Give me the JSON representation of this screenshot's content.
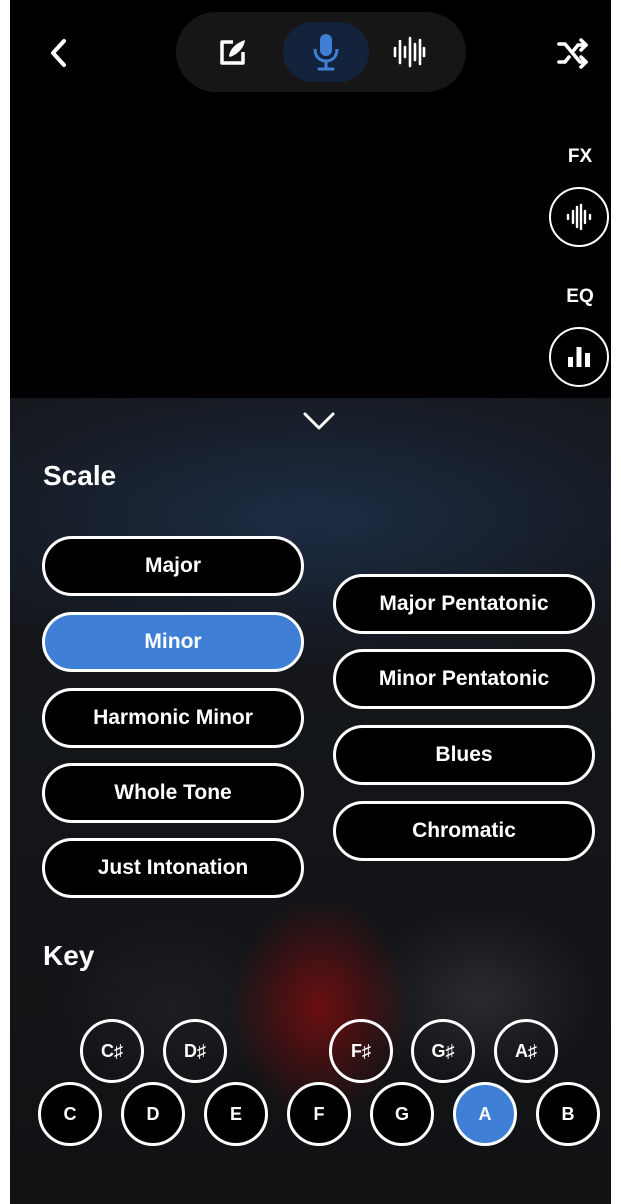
{
  "header": {
    "back_icon": "chevron-left-icon",
    "modes": [
      {
        "icon": "edit-icon",
        "active": false
      },
      {
        "icon": "microphone-icon",
        "active": true
      },
      {
        "icon": "waveform-icon",
        "active": false
      }
    ],
    "shuffle_icon": "shuffle-icon"
  },
  "controls": {
    "fx_label": "FX",
    "fx_icon": "audio-wave-icon",
    "eq_label": "EQ",
    "eq_icon": "bar-chart-icon"
  },
  "panel": {
    "collapse_icon": "chevron-down-icon",
    "scale_title": "Scale",
    "scales_left": [
      "Major",
      "Minor",
      "Harmonic Minor",
      "Whole Tone",
      "Just Intonation"
    ],
    "scales_right": [
      "Major Pentatonic",
      "Minor Pentatonic",
      "Blues",
      "Chromatic"
    ],
    "selected_scale": "Minor",
    "key_title": "Key",
    "sharp_keys": [
      "C♯",
      "D♯",
      "F♯",
      "G♯",
      "A♯"
    ],
    "natural_keys": [
      "C",
      "D",
      "E",
      "F",
      "G",
      "A",
      "B"
    ],
    "selected_key": "A"
  },
  "colors": {
    "accent": "#3f7fd6",
    "background": "#000000",
    "active_tab": "#13233c"
  }
}
